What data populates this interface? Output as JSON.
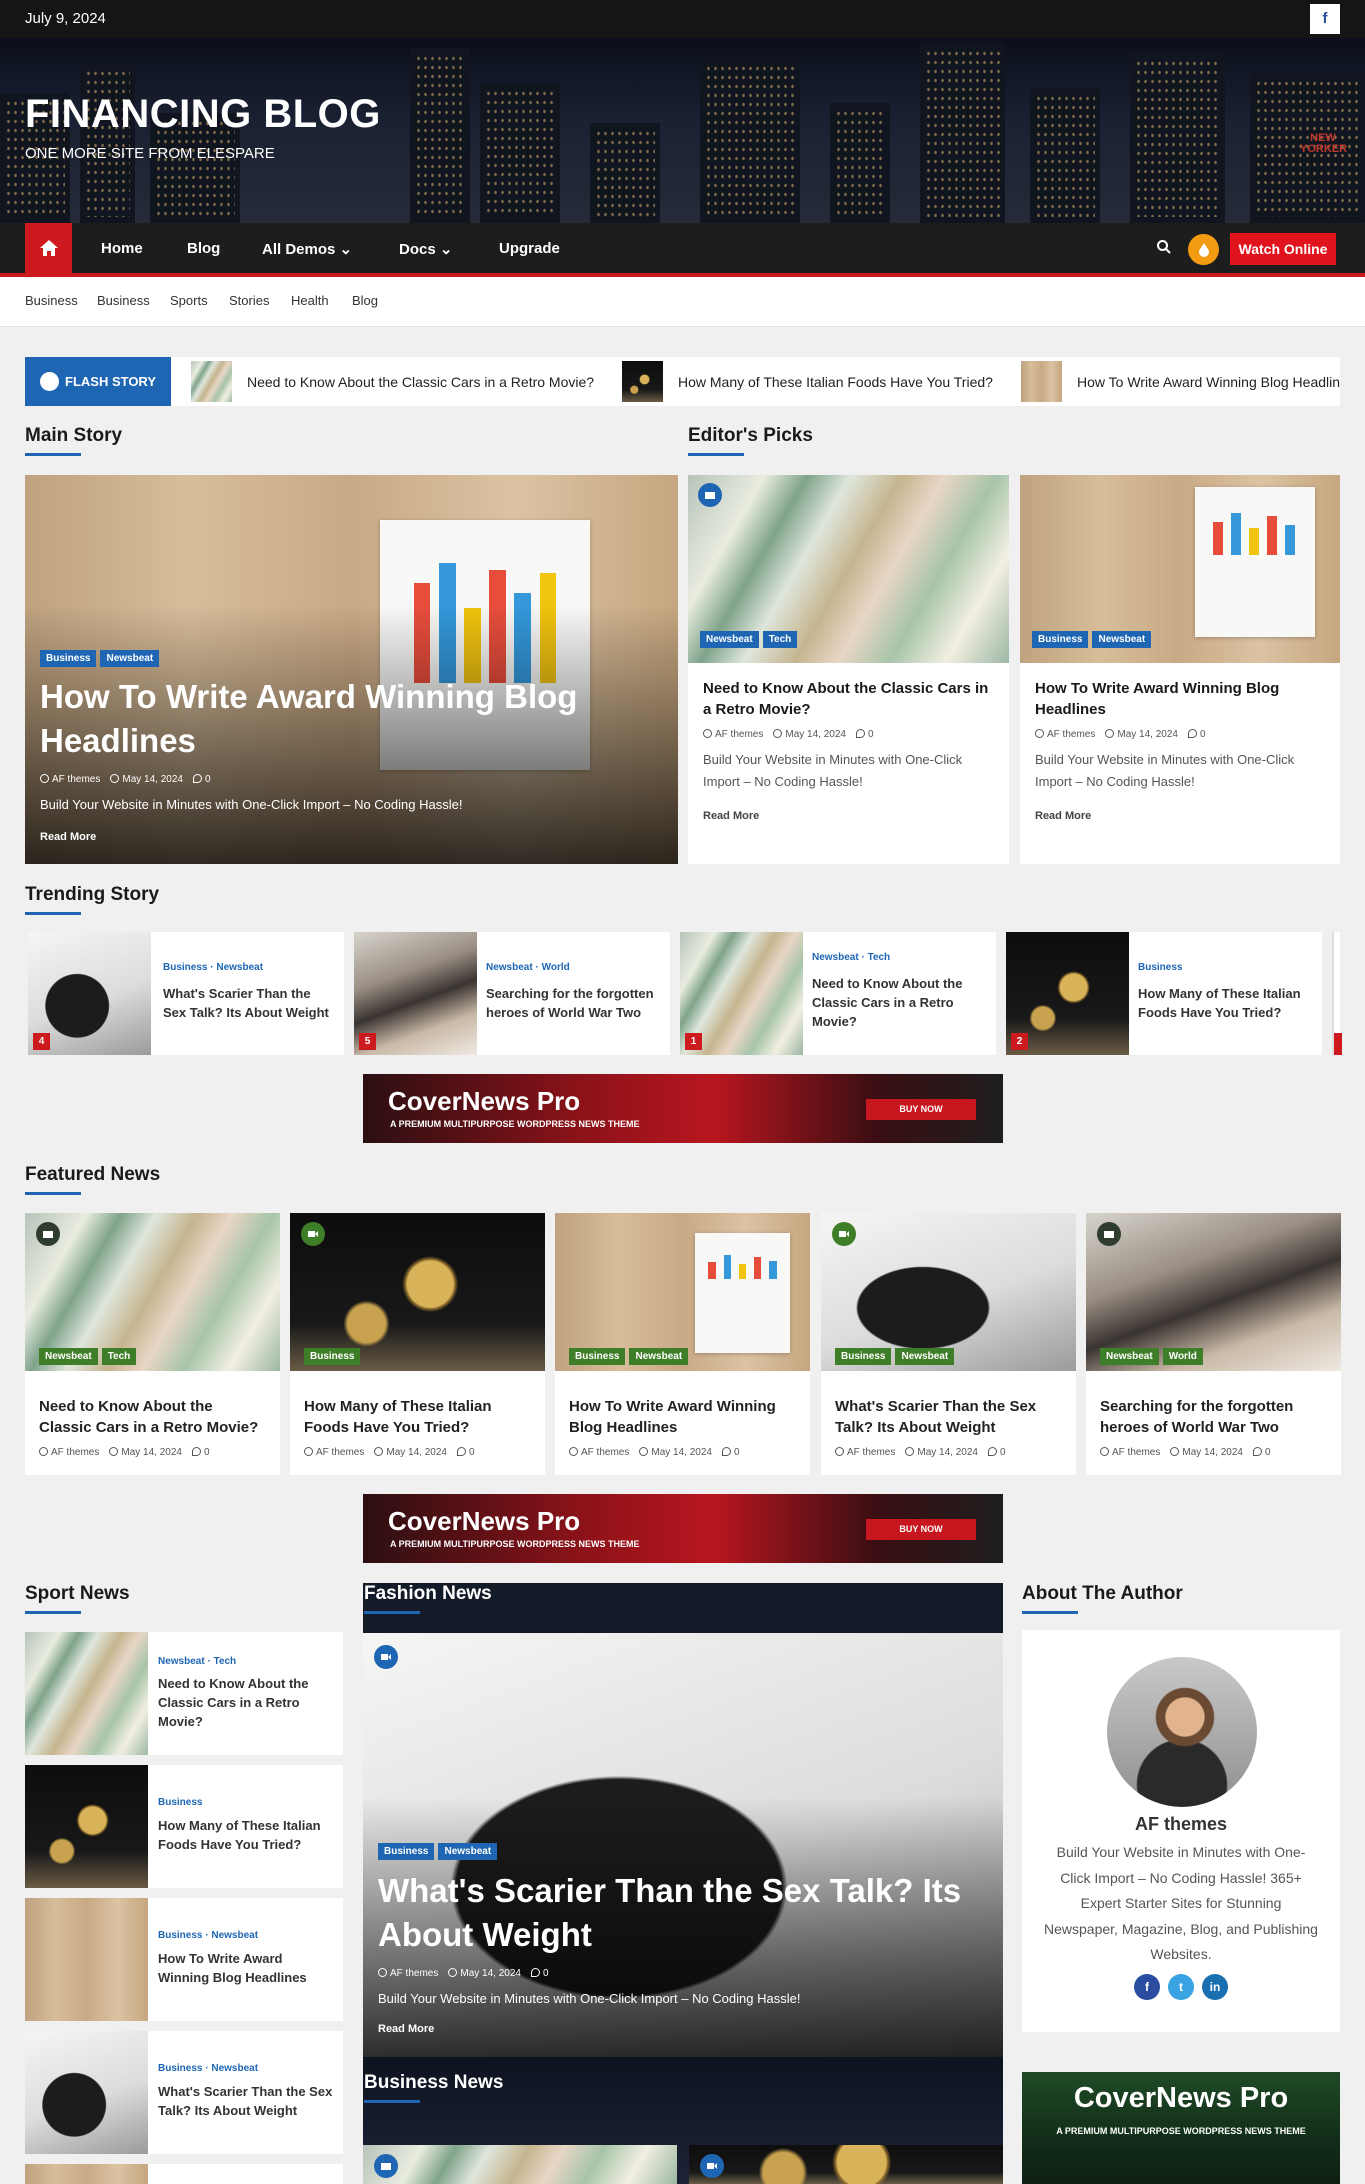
{
  "topbar": {
    "date": "July 9, 2024",
    "social_icon": "f"
  },
  "header": {
    "title": "FINANCING BLOG",
    "tagline": "ONE MORE SITE FROM ELESPARE",
    "sign_text": "NEW YORKER"
  },
  "nav": {
    "items": [
      "Home",
      "Blog",
      "All Demos",
      "Docs",
      "Upgrade"
    ],
    "watch_label": "Watch Online",
    "icons": [
      "home-icon",
      "search-icon",
      "dark-mode-icon"
    ]
  },
  "submenu": {
    "items": [
      "Business",
      "Business",
      "Sports",
      "Stories",
      "Health",
      "Blog"
    ]
  },
  "flash": {
    "label": "FLASH STORY",
    "items": [
      "Need to Know About the Classic Cars in a Retro Movie?",
      "How Many of These Italian Foods Have You Tried?",
      "How To Write Award Winning Blog Headlin"
    ]
  },
  "sections": {
    "main_story": "Main Story",
    "editors_picks": "Editor's Picks",
    "trending": "Trending Story",
    "featured": "Featured News",
    "sport": "Sport News",
    "fashion": "Fashion News",
    "author": "About The Author",
    "business": "Business News"
  },
  "main_story": {
    "tags": [
      "Business",
      "Newsbeat"
    ],
    "title": "How To Write Award Winning Blog Headlines",
    "author": "AF themes",
    "date": "May 14, 2024",
    "comments": "0",
    "excerpt": "Build Your Website in Minutes with One-Click Import – No Coding Hassle!",
    "read_more": "Read More"
  },
  "editors_picks": [
    {
      "tags": [
        "Newsbeat",
        "Tech"
      ],
      "title": "Need to Know About the Classic Cars in a Retro Movie?",
      "author": "AF themes",
      "date": "May 14, 2024",
      "comments": "0",
      "excerpt": "Build Your Website in Minutes with One-Click Import – No Coding Hassle!",
      "read_more": "Read More"
    },
    {
      "tags": [
        "Business",
        "Newsbeat"
      ],
      "title": "How To Write Award Winning Blog Headlines",
      "author": "AF themes",
      "date": "May 14, 2024",
      "comments": "0",
      "excerpt": "Build Your Website in Minutes with One-Click Import – No Coding Hassle!",
      "read_more": "Read More"
    }
  ],
  "trending": [
    {
      "num": "4",
      "cats": "Business ·  Newsbeat",
      "title": "What's Scarier Than the Sex Talk? Its About Weight"
    },
    {
      "num": "5",
      "cats": "Newsbeat ·  World",
      "title": "Searching for the forgotten heroes of World War Two"
    },
    {
      "num": "1",
      "cats": "Newsbeat ·  Tech",
      "title": "Need to Know About the Classic Cars in a Retro Movie?"
    },
    {
      "num": "2",
      "cats": "Business",
      "title": "How Many of These Italian Foods Have You Tried?"
    }
  ],
  "banner": {
    "title": "CoverNews Pro",
    "subtitle": "A PREMIUM MULTIPURPOSE WORDPRESS NEWS THEME",
    "button": "BUY NOW"
  },
  "featured": [
    {
      "tags": [
        "Newsbeat",
        "Tech"
      ],
      "title": "Need to Know About the Classic Cars in a Retro Movie?",
      "author": "AF themes",
      "date": "May 14, 2024",
      "comments": "0"
    },
    {
      "tags": [
        "Business"
      ],
      "title": "How Many of These Italian Foods Have You Tried?",
      "author": "AF themes",
      "date": "May 14, 2024",
      "comments": "0"
    },
    {
      "tags": [
        "Business",
        "Newsbeat"
      ],
      "title": "How To Write Award Winning Blog Headlines",
      "author": "AF themes",
      "date": "May 14, 2024",
      "comments": "0"
    },
    {
      "tags": [
        "Business",
        "Newsbeat"
      ],
      "title": "What's Scarier Than the Sex Talk? Its About Weight",
      "author": "AF themes",
      "date": "May 14, 2024",
      "comments": "0"
    },
    {
      "tags": [
        "Newsbeat",
        "World"
      ],
      "title": "Searching for the forgotten heroes of World War Two",
      "author": "AF themes",
      "date": "May 14, 2024",
      "comments": "0"
    }
  ],
  "sport": [
    {
      "cats": "Newsbeat ·  Tech",
      "title": "Need to Know About the Classic Cars in a Retro Movie?"
    },
    {
      "cats": "Business",
      "title": "How Many of These Italian Foods Have You Tried?"
    },
    {
      "cats": "Business ·  Newsbeat",
      "title": "How To Write Award Winning Blog Headlines"
    },
    {
      "cats": "Business ·  Newsbeat",
      "title": "What's Scarier Than the Sex Talk? Its About Weight"
    }
  ],
  "fashion": {
    "tags": [
      "Business",
      "Newsbeat"
    ],
    "title": "What's Scarier Than the Sex Talk? Its About Weight",
    "author": "AF themes",
    "date": "May 14, 2024",
    "comments": "0",
    "excerpt": "Build Your Website in Minutes with One-Click Import – No Coding Hassle!",
    "read_more": "Read More"
  },
  "author": {
    "name": "AF themes",
    "bio": "Build Your Website in Minutes with One-Click Import – No Coding Hassle! 365+ Expert Starter Sites for Stunning Newspaper, Magazine, Blog, and Publishing Websites.",
    "social": [
      "f",
      "t",
      "in"
    ]
  },
  "side_banner": {
    "title": "CoverNews Pro",
    "subtitle": "A PREMIUM MULTIPURPOSE WORDPRESS NEWS THEME"
  },
  "colors": {
    "accent_red": "#cc1a1f",
    "accent_blue": "#1e66b4",
    "tag_green": "#3f7e28"
  }
}
